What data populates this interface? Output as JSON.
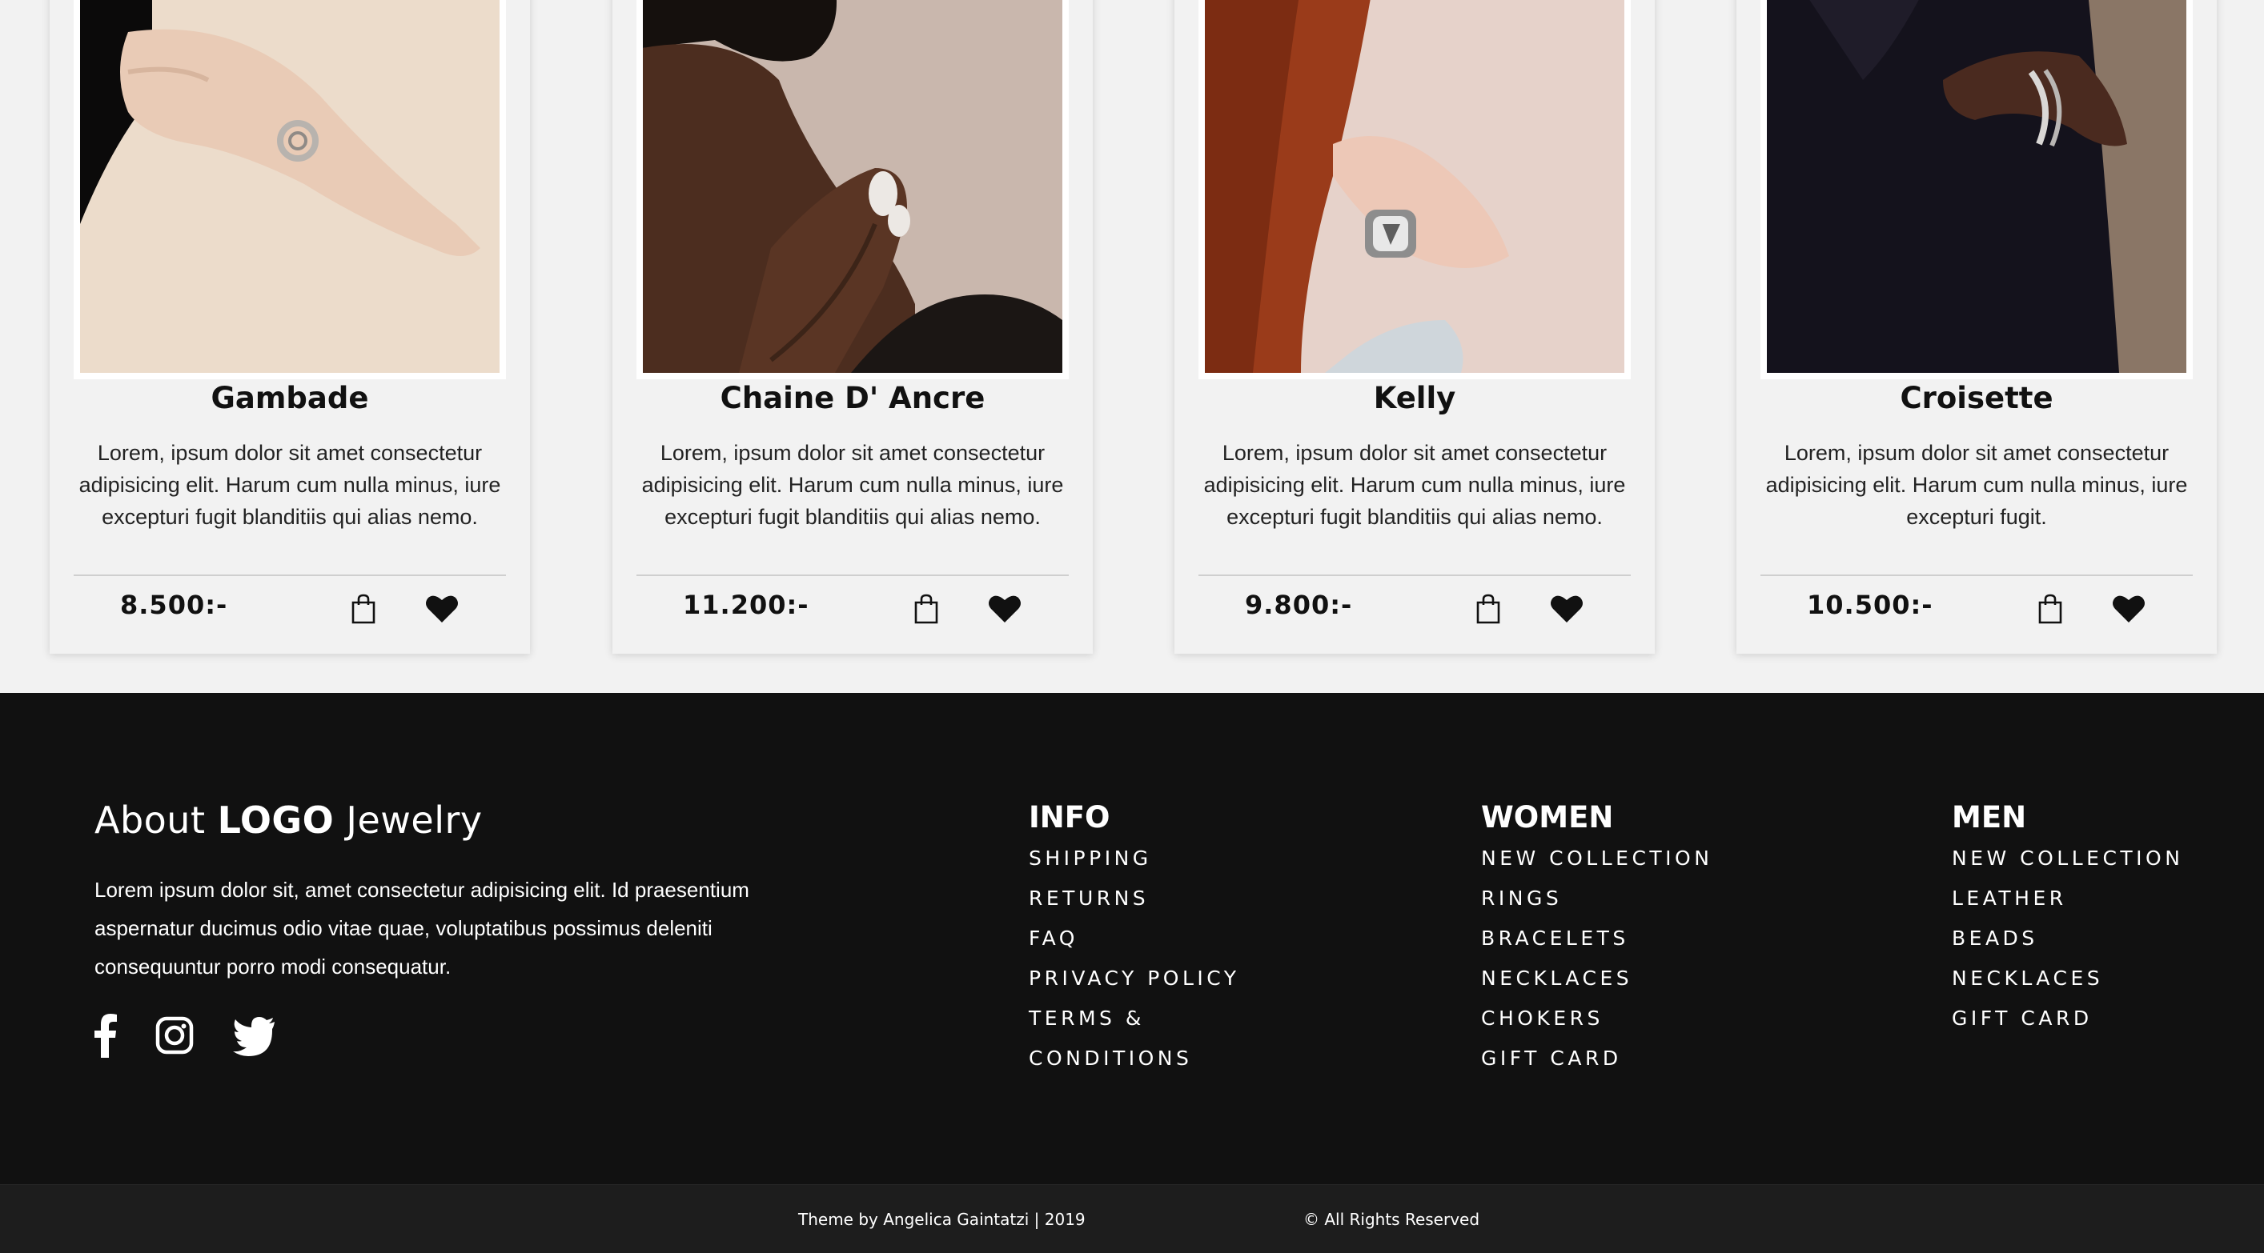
{
  "products": [
    {
      "title": "Gambade",
      "description": "Lorem, ipsum dolor sit amet consectetur adipisicing elit. Harum cum nulla minus, iure excepturi fugit blanditiis qui alias nemo.",
      "price": "8.500:-"
    },
    {
      "title": "Chaine D' Ancre",
      "description": "Lorem, ipsum dolor sit amet consectetur adipisicing elit. Harum cum nulla minus, iure excepturi fugit blanditiis qui alias nemo.",
      "price": "11.200:-"
    },
    {
      "title": "Kelly",
      "description": "Lorem, ipsum dolor sit amet consectetur adipisicing elit. Harum cum nulla minus, iure excepturi fugit blanditiis qui alias nemo.",
      "price": "9.800:-"
    },
    {
      "title": "Croisette",
      "description": "Lorem, ipsum dolor sit amet consectetur adipisicing elit. Harum cum nulla minus, iure excepturi fugit.",
      "price": "10.500:-"
    }
  ],
  "icons": {
    "cart": "shopping-bag-icon",
    "wishlist": "heart-icon",
    "social": [
      "facebook-icon",
      "instagram-icon",
      "twitter-icon"
    ]
  },
  "footer": {
    "about": {
      "prefix": "About",
      "brand": "LOGO",
      "suffix": "Jewelry",
      "text": "Lorem ipsum dolor sit, amet consectetur adipisicing elit. Id praesentium aspernatur ducimus odio vitae quae, voluptatibus possimus deleniti consequuntur porro modi consequatur."
    },
    "columns": {
      "info": {
        "title": "INFO",
        "links": [
          "SHIPPING",
          "RETURNS",
          "FAQ",
          "PRIVACY POLICY",
          "TERMS & CONDITIONS"
        ]
      },
      "women": {
        "title": "WOMEN",
        "links": [
          "NEW COLLECTION",
          "RINGS",
          "BRACELETS",
          "NECKLACES",
          "CHOKERS",
          "GIFT CARD"
        ]
      },
      "men": {
        "title": "MEN",
        "links": [
          "NEW COLLECTION",
          "LEATHER",
          "BEADS",
          "NECKLACES",
          "GIFT CARD"
        ]
      }
    },
    "credit": "Theme by Angelica Gaintatzi | 2019",
    "rights": "© All Rights Reserved"
  },
  "colors": {
    "page_bg": "#f2f2f2",
    "footer_bg": "#111111",
    "bottom_bar_bg": "#1d1d1d",
    "text_dark": "#111111",
    "text_light": "#ffffff"
  }
}
